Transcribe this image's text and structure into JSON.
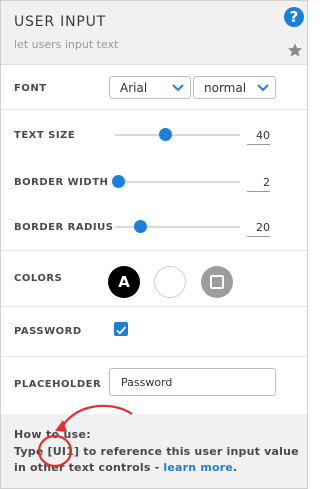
{
  "header": {
    "title": "USER INPUT",
    "subtitle": "let users input text",
    "help_icon": "question-circle-icon",
    "help_glyph": "?",
    "star_icon": "star-icon"
  },
  "font": {
    "label": "FONT",
    "family": "Arial",
    "weight": "normal"
  },
  "text_size": {
    "label": "TEXT SIZE",
    "value": "40",
    "min": 0,
    "max": 100
  },
  "border_width": {
    "label": "BORDER WIDTH",
    "value": "2",
    "min": 0,
    "max": 100
  },
  "border_radius": {
    "label": "BORDER RADIUS",
    "value": "20",
    "min": 0,
    "max": 100
  },
  "colors": {
    "label": "COLORS",
    "text_swatch_glyph": "A",
    "text_color": "#000000",
    "background_color": "#ffffff",
    "border_color": "#9d9d9d"
  },
  "password": {
    "label": "PASSWORD",
    "checked": true
  },
  "placeholder": {
    "label": "PLACEHOLDER",
    "value": "Password"
  },
  "howto": {
    "title": "How to use:",
    "body": "Type [UI1] to reference this user input value in other text controls - ",
    "link": "learn more",
    "after_link": "."
  },
  "accent_color": "#1e7fd6",
  "annotation_color": "#e03030"
}
